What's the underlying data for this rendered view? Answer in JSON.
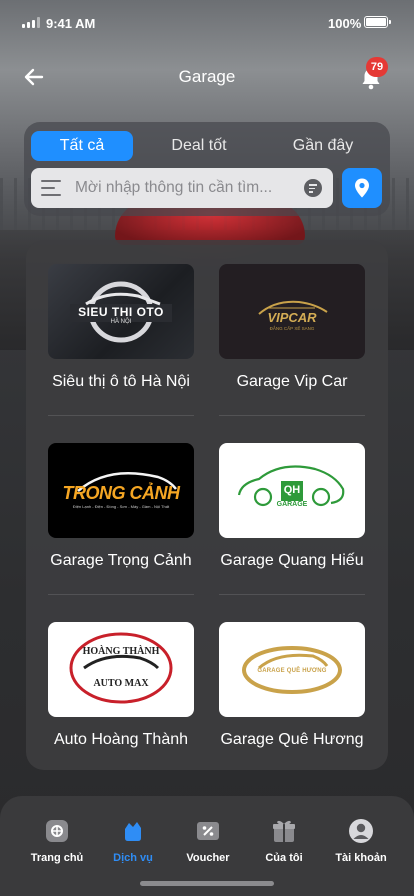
{
  "status": {
    "time": "9:41 AM",
    "battery": "100%"
  },
  "header": {
    "title": "Garage",
    "notification_count": "79"
  },
  "tabs": [
    {
      "label": "Tất cả",
      "active": true
    },
    {
      "label": "Deal tốt",
      "active": false
    },
    {
      "label": "Gần đây",
      "active": false
    }
  ],
  "search": {
    "placeholder": "Mời nhập thông tin cần tìm...",
    "value": ""
  },
  "garages": [
    {
      "name": "Siêu thị ô tô Hà Nội",
      "logo_text": "SIEU THI OTO",
      "logo_sub": "HÀ NỘI"
    },
    {
      "name": "Garage Vip Car",
      "logo_text": "VIPCAR",
      "logo_sub": "ĐẲNG CẤP XẾ SANG"
    },
    {
      "name": "Garage Trọng Cảnh",
      "logo_text": "TRONG CẢNH",
      "logo_sub": "Điện Lạnh - Điện - Đồng - Sơn - Máy - Gầm - Nội Thất"
    },
    {
      "name": "Garage Quang Hiếu",
      "logo_text": "QH",
      "logo_sub": "GARAGE"
    },
    {
      "name": "Auto Hoàng Thành",
      "logo_text": "HOÀNG THÀNH",
      "logo_sub": "AUTO MAX"
    },
    {
      "name": "Garage Quê Hương",
      "logo_text": "GARAGE QUÊ HƯƠNG"
    }
  ],
  "bottom_nav": [
    {
      "label": "Trang chủ",
      "icon": "home-icon",
      "active": false
    },
    {
      "label": "Dịch vụ",
      "icon": "services-icon",
      "active": true
    },
    {
      "label": "Voucher",
      "icon": "voucher-icon",
      "active": false
    },
    {
      "label": "Của tôi",
      "icon": "gift-icon",
      "active": false
    },
    {
      "label": "Tài khoản",
      "icon": "account-icon",
      "active": false
    }
  ],
  "colors": {
    "accent": "#1f8fff",
    "badge": "#e53935",
    "nav_active": "#2f8df5"
  }
}
